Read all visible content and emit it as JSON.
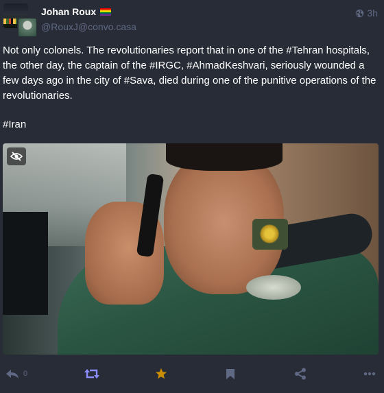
{
  "status": {
    "author": {
      "display_name": "Johan Roux",
      "flag_emoji_name": "rainbow-flag",
      "handle": "@RouxJ@convo.casa"
    },
    "visibility_icon": "globe-icon",
    "timestamp": "3h",
    "content": {
      "paragraph_1": "Not only colonels. The revolutionaries report that in one of the #Tehran hospitals, the other day, the captain of the #IRGC, #AhmadKeshvari, seriously wounded a few days ago in the city of #Sava, died during one of the punitive operations of the revolutionaries.",
      "paragraph_2": "#Iran"
    },
    "media": {
      "sensitive_toggle_icon": "eye-slash-icon"
    },
    "actions": {
      "reply_icon": "reply-icon",
      "reply_count": "0",
      "boost_icon": "retweet-icon",
      "favourite_icon": "star-icon",
      "bookmark_icon": "bookmark-icon",
      "share_icon": "share-icon",
      "more_icon": "ellipsis-icon"
    }
  },
  "colors": {
    "background": "#282c37",
    "muted_text": "#606984",
    "boost_active": "#8c8dff",
    "favourite_active": "#ca8f04",
    "text": "#ffffff"
  }
}
